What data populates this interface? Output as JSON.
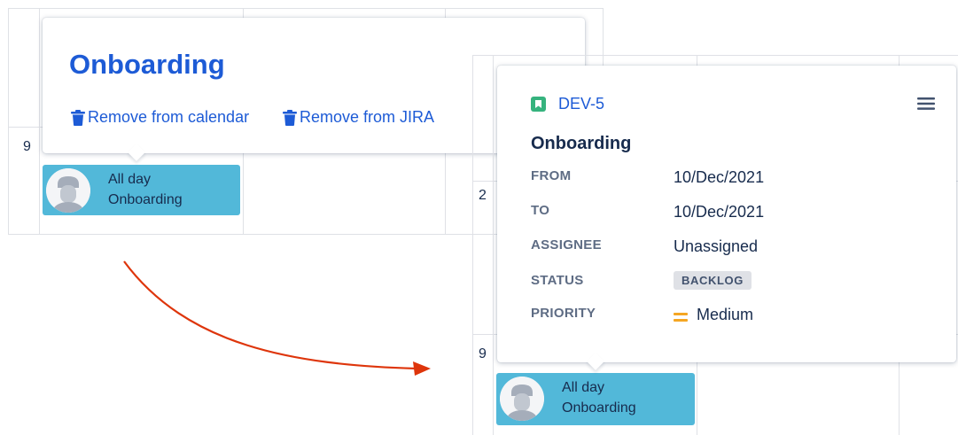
{
  "left": {
    "day_number": "9",
    "event": {
      "time": "All day",
      "title": "Onboarding"
    },
    "popup": {
      "title": "Onboarding",
      "actions": [
        {
          "label": "Remove from calendar",
          "icon": "trash-icon"
        },
        {
          "label": "Remove from JIRA",
          "icon": "trash-icon"
        }
      ]
    }
  },
  "right": {
    "day_numbers": [
      "2",
      "9"
    ],
    "event": {
      "time": "All day",
      "title": "Onboarding"
    },
    "popup": {
      "issue_key": "DEV-5",
      "issue_type_icon": "story-icon",
      "menu_icon": "hamburger-menu-icon",
      "title": "Onboarding",
      "fields": {
        "from": {
          "label": "FROM",
          "value": "10/Dec/2021"
        },
        "to": {
          "label": "TO",
          "value": "10/Dec/2021"
        },
        "assignee": {
          "label": "ASSIGNEE",
          "value": "Unassigned"
        },
        "status": {
          "label": "STATUS",
          "value": "BACKLOG"
        },
        "priority": {
          "label": "PRIORITY",
          "value": "Medium",
          "icon": "priority-medium-icon"
        }
      }
    }
  },
  "colors": {
    "event_bg": "#52b8d9",
    "link": "#1d5bd6",
    "story_icon": "#36b37e",
    "priority_medium": "#f5a623",
    "arrow": "#de350b"
  }
}
